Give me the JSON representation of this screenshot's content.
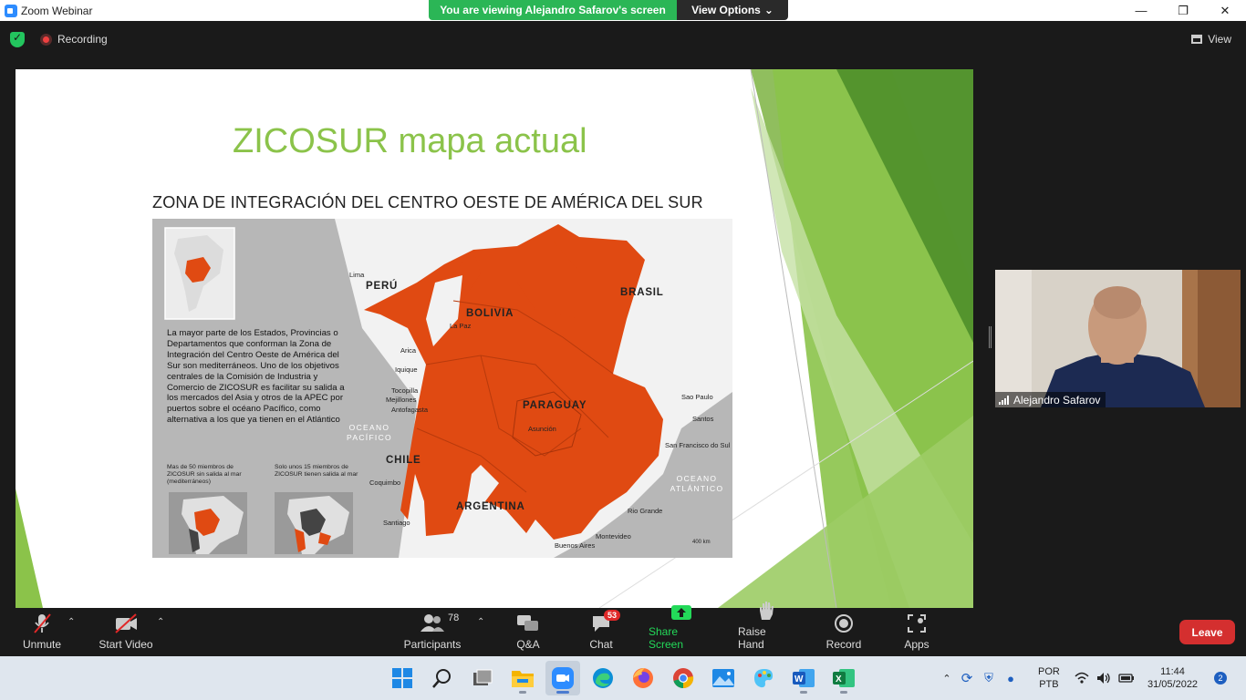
{
  "window": {
    "title": "Zoom Webinar",
    "controls": [
      "minimize-icon",
      "maximize-icon",
      "close-icon"
    ]
  },
  "share_banner": {
    "viewing": "You are viewing Alejandro Safarov's screen",
    "view_options": "View Options",
    "accent": "#2bb656"
  },
  "topbar": {
    "recording": "Recording",
    "view": "View"
  },
  "slide": {
    "title": "ZICOSUR mapa actual",
    "subtitle": "ZONA DE INTEGRACIÓN DEL CENTRO OESTE DE AMÉRICA DEL SUR",
    "title_color": "#8bc34a",
    "map": {
      "description": "La mayor parte de los Estados, Provincias o Departamentos que conforman la Zona de Integración del Centro Oeste de América del Sur son mediterráneos. Uno de los objetivos centrales de la Comisión de Industria y Comercio de ZICOSUR es facilitar su salida a los mercados del Asia y otros de la APEC por puertos sobre el océano Pacífico, como alternativa a los que ya tienen en el Atlántico",
      "countries": [
        "PERÚ",
        "BOLIVIA",
        "BRASIL",
        "PARAGUAY",
        "CHILE",
        "ARGENTINA"
      ],
      "cities": [
        "Lima",
        "La Paz",
        "Arica",
        "Iquique",
        "Tocopilla",
        "Mejillones",
        "Antofagasta",
        "Asunción",
        "Sao Paulo",
        "Santos",
        "San Francisco do Sul",
        "Coquimbo",
        "Santiago",
        "Rio Grande",
        "Montevideo",
        "Buenos Aires"
      ],
      "ocean_pacific": "OCEANO PACÍFICO",
      "ocean_atlantic": "OCEANO ATLÁNTICO",
      "inset1_caption": "Mas de 50 miembros de ZICOSUR sin salida al mar (mediterráneos)",
      "inset2_caption": "Solo unos 15 miembros de ZICOSUR tienen salida al mar",
      "scale": "400 km",
      "zone_color": "#e04a12"
    }
  },
  "participant": {
    "name": "Alejandro Safarov"
  },
  "toolbar": {
    "unmute": "Unmute",
    "start_video": "Start Video",
    "participants": "Participants",
    "participants_count": "78",
    "qa": "Q&A",
    "chat": "Chat",
    "chat_badge": "53",
    "share_screen": "Share Screen",
    "raise_hand": "Raise Hand",
    "record": "Record",
    "apps": "Apps",
    "leave": "Leave",
    "share_color": "#23d959",
    "leave_color": "#d42f2f"
  },
  "taskbar": {
    "apps": [
      "windows-start-icon",
      "search-icon",
      "task-view-icon",
      "file-explorer-icon",
      "zoom-icon",
      "edge-icon",
      "firefox-icon",
      "chrome-icon",
      "photos-icon",
      "paint-icon",
      "word-icon",
      "excel-icon"
    ],
    "lang_1": "POR",
    "lang_2": "PTB",
    "time": "11:44",
    "date": "31/05/2022",
    "notifications": "2"
  }
}
